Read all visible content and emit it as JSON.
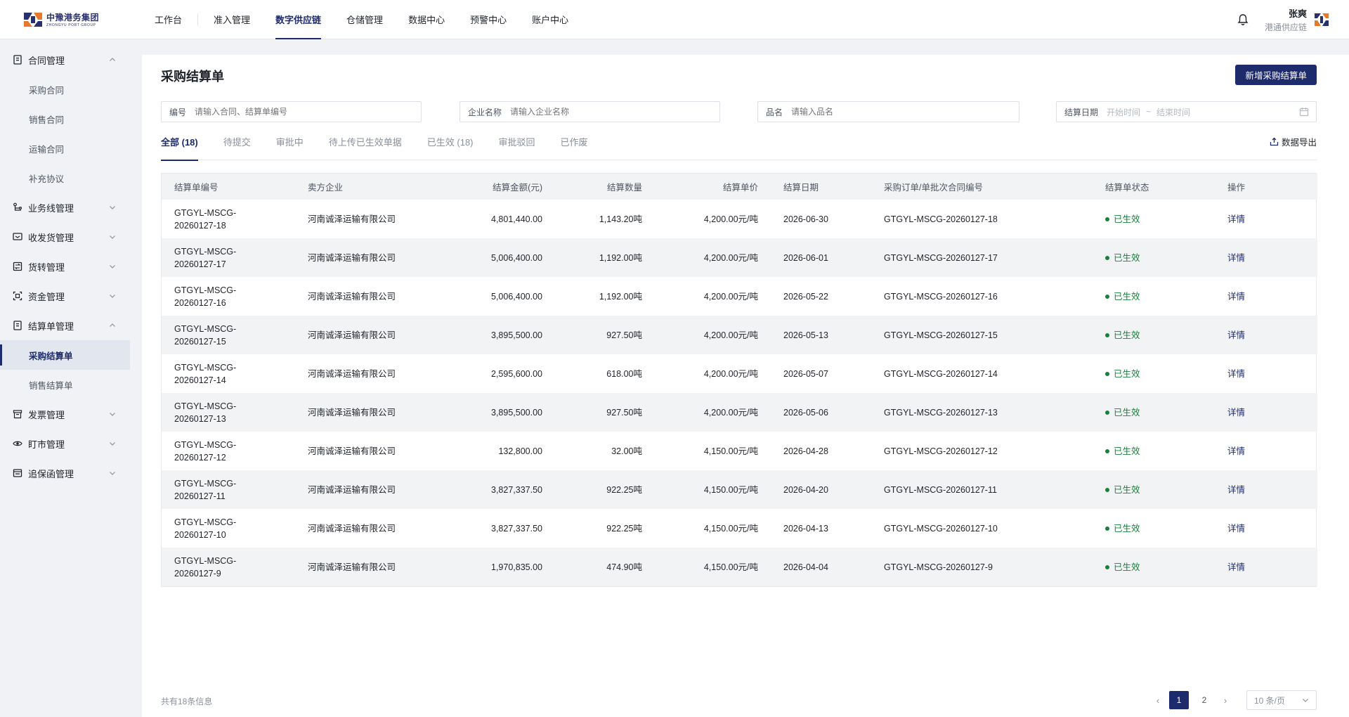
{
  "logo": {
    "cn": "中豫港务集团",
    "en": "ZHONGYU PORT GROUP"
  },
  "nav": {
    "home": "工作台",
    "items": [
      "准入管理",
      "数字供应链",
      "仓储管理",
      "数据中心",
      "预警中心",
      "账户中心"
    ],
    "active_index": 1
  },
  "user": {
    "name": "张爽",
    "org": "港通供应链"
  },
  "sidebar": {
    "groups": [
      {
        "label": "合同管理",
        "icon": "contract-icon",
        "expanded": true,
        "children": [
          "采购合同",
          "销售合同",
          "运输合同",
          "补充协议"
        ]
      },
      {
        "label": "业务线管理",
        "icon": "business-line-icon",
        "expanded": false
      },
      {
        "label": "收发货管理",
        "icon": "shipping-icon",
        "expanded": false
      },
      {
        "label": "货转管理",
        "icon": "transfer-icon",
        "expanded": false
      },
      {
        "label": "资金管理",
        "icon": "fund-icon",
        "expanded": false
      },
      {
        "label": "结算单管理",
        "icon": "settlement-icon",
        "expanded": true,
        "children": [
          "采购结算单",
          "销售结算单"
        ],
        "active_child": 0
      },
      {
        "label": "发票管理",
        "icon": "invoice-icon",
        "expanded": false
      },
      {
        "label": "盯市管理",
        "icon": "eye-icon",
        "expanded": false
      },
      {
        "label": "追保函管理",
        "icon": "guarantee-icon",
        "expanded": false
      }
    ]
  },
  "page": {
    "title": "采购结算单",
    "add_button": "新增采购结算单"
  },
  "filters": {
    "code": {
      "label": "编号",
      "placeholder": "请输入合同、结算单编号"
    },
    "company": {
      "label": "企业名称",
      "placeholder": "请输入企业名称"
    },
    "product": {
      "label": "品名",
      "placeholder": "请输入品名"
    },
    "date": {
      "label": "结算日期",
      "start_placeholder": "开始时间",
      "sep": "~",
      "end_placeholder": "结束时间"
    }
  },
  "tabs": [
    "全部 (18)",
    "待提交",
    "审批中",
    "待上传已生效单据",
    "已生效 (18)",
    "审批驳回",
    "已作废"
  ],
  "active_tab": 0,
  "export_label": "数据导出",
  "table": {
    "columns": [
      "结算单编号",
      "卖方企业",
      "结算金额(元)",
      "结算数量",
      "结算单价",
      "结算日期",
      "采购订单/单批次合同编号",
      "结算单状态",
      "操作"
    ],
    "rows": [
      {
        "code1": "GTGYL-MSCG-",
        "code2": "20260127-18",
        "seller": "河南诚泽运输有限公司",
        "amount": "4,801,440.00",
        "qty": "1,143.20吨",
        "price": "4,200.00元/吨",
        "date": "2026-06-30",
        "contract": "GTGYL-MSCG-20260127-18",
        "status": "已生效",
        "action": "详情"
      },
      {
        "code1": "GTGYL-MSCG-",
        "code2": "20260127-17",
        "seller": "河南诚泽运输有限公司",
        "amount": "5,006,400.00",
        "qty": "1,192.00吨",
        "price": "4,200.00元/吨",
        "date": "2026-06-01",
        "contract": "GTGYL-MSCG-20260127-17",
        "status": "已生效",
        "action": "详情"
      },
      {
        "code1": "GTGYL-MSCG-",
        "code2": "20260127-16",
        "seller": "河南诚泽运输有限公司",
        "amount": "5,006,400.00",
        "qty": "1,192.00吨",
        "price": "4,200.00元/吨",
        "date": "2026-05-22",
        "contract": "GTGYL-MSCG-20260127-16",
        "status": "已生效",
        "action": "详情"
      },
      {
        "code1": "GTGYL-MSCG-",
        "code2": "20260127-15",
        "seller": "河南诚泽运输有限公司",
        "amount": "3,895,500.00",
        "qty": "927.50吨",
        "price": "4,200.00元/吨",
        "date": "2026-05-13",
        "contract": "GTGYL-MSCG-20260127-15",
        "status": "已生效",
        "action": "详情"
      },
      {
        "code1": "GTGYL-MSCG-",
        "code2": "20260127-14",
        "seller": "河南诚泽运输有限公司",
        "amount": "2,595,600.00",
        "qty": "618.00吨",
        "price": "4,200.00元/吨",
        "date": "2026-05-07",
        "contract": "GTGYL-MSCG-20260127-14",
        "status": "已生效",
        "action": "详情"
      },
      {
        "code1": "GTGYL-MSCG-",
        "code2": "20260127-13",
        "seller": "河南诚泽运输有限公司",
        "amount": "3,895,500.00",
        "qty": "927.50吨",
        "price": "4,200.00元/吨",
        "date": "2026-05-06",
        "contract": "GTGYL-MSCG-20260127-13",
        "status": "已生效",
        "action": "详情"
      },
      {
        "code1": "GTGYL-MSCG-",
        "code2": "20260127-12",
        "seller": "河南诚泽运输有限公司",
        "amount": "132,800.00",
        "qty": "32.00吨",
        "price": "4,150.00元/吨",
        "date": "2026-04-28",
        "contract": "GTGYL-MSCG-20260127-12",
        "status": "已生效",
        "action": "详情"
      },
      {
        "code1": "GTGYL-MSCG-",
        "code2": "20260127-11",
        "seller": "河南诚泽运输有限公司",
        "amount": "3,827,337.50",
        "qty": "922.25吨",
        "price": "4,150.00元/吨",
        "date": "2026-04-20",
        "contract": "GTGYL-MSCG-20260127-11",
        "status": "已生效",
        "action": "详情"
      },
      {
        "code1": "GTGYL-MSCG-",
        "code2": "20260127-10",
        "seller": "河南诚泽运输有限公司",
        "amount": "3,827,337.50",
        "qty": "922.25吨",
        "price": "4,150.00元/吨",
        "date": "2026-04-13",
        "contract": "GTGYL-MSCG-20260127-10",
        "status": "已生效",
        "action": "详情"
      },
      {
        "code1": "GTGYL-MSCG-",
        "code2": "20260127-9",
        "seller": "河南诚泽运输有限公司",
        "amount": "1,970,835.00",
        "qty": "474.90吨",
        "price": "4,150.00元/吨",
        "date": "2026-04-04",
        "contract": "GTGYL-MSCG-20260127-9",
        "status": "已生效",
        "action": "详情"
      }
    ]
  },
  "pagination": {
    "total_text": "共有18条信息",
    "pages": [
      "1",
      "2"
    ],
    "current": "1",
    "prev": "‹",
    "next": "›",
    "page_size": "10 条/页"
  },
  "colors": {
    "primary": "#1d2a6b",
    "success": "#1a7f3c",
    "logo_orange": "#e8792b"
  }
}
